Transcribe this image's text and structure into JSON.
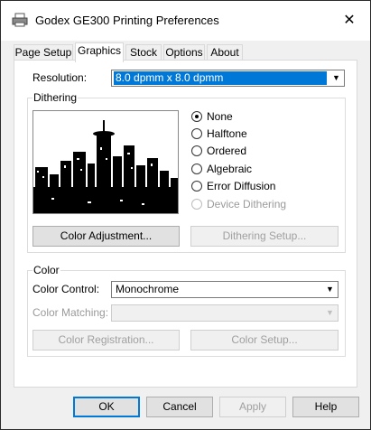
{
  "window": {
    "title": "Godex GE300 Printing Preferences",
    "close_glyph": "✕"
  },
  "tabs": [
    {
      "label": "Page Setup"
    },
    {
      "label": "Graphics"
    },
    {
      "label": "Stock"
    },
    {
      "label": "Options"
    },
    {
      "label": "About"
    }
  ],
  "resolution": {
    "label": "Resolution:",
    "value": "8.0 dpmm x 8.0 dpmm"
  },
  "dithering": {
    "title": "Dithering",
    "options": [
      "None",
      "Halftone",
      "Ordered",
      "Algebraic",
      "Error Diffusion",
      "Device Dithering"
    ],
    "selected": "None",
    "color_adjustment_label": "Color Adjustment...",
    "dithering_setup_label": "Dithering Setup..."
  },
  "color": {
    "title": "Color",
    "control_label": "Color Control:",
    "control_value": "Monochrome",
    "matching_label": "Color Matching:",
    "matching_value": "",
    "registration_label": "Color Registration...",
    "setup_label": "Color Setup..."
  },
  "footer": {
    "ok": "OK",
    "cancel": "Cancel",
    "apply": "Apply",
    "help": "Help"
  },
  "arrow_glyph": "▼"
}
